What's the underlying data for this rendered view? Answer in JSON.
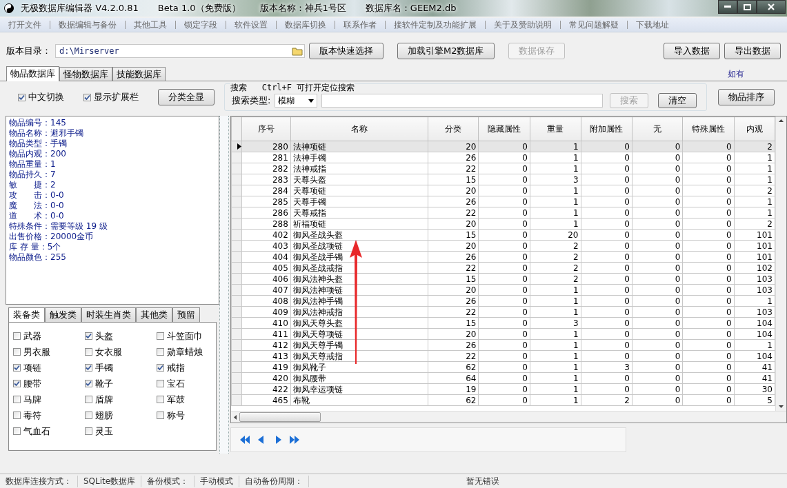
{
  "window": {
    "title_parts": [
      "无极数据库编辑器 V4.2.0.81",
      "Beta 1.0（免费版）",
      "版本名称：神兵1号区",
      "数据库名：GEEM2.db"
    ]
  },
  "menu": [
    "打开文件",
    "数据编辑与备份",
    "其他工具",
    "锁定字段",
    "软件设置",
    "数据库切换",
    "联系作者",
    "接软件定制及功能扩展",
    "关于及赞助说明",
    "常见问题解疑",
    "下载地址"
  ],
  "toolbar": {
    "dir_label": "版本目录：",
    "dir_value": "d:\\Mirserver",
    "buttons": [
      {
        "label": "版本快速选择",
        "disabled": false
      },
      {
        "label": "加载引擎M2数据库",
        "disabled": false
      },
      {
        "label": "数据保存",
        "disabled": true
      },
      {
        "label": "导入数据",
        "disabled": false
      },
      {
        "label": "导出数据",
        "disabled": false
      }
    ]
  },
  "main_tabs": [
    {
      "label": "物品数据库",
      "selected": true
    },
    {
      "label": "怪物数据库",
      "selected": false
    },
    {
      "label": "技能数据库",
      "selected": false
    }
  ],
  "link": "如有",
  "options": [
    {
      "label": "中文切换",
      "checked": true
    },
    {
      "label": "显示扩展栏",
      "checked": true
    }
  ],
  "show_all_button": "分类全显",
  "search": {
    "title": "搜索",
    "hint": "Ctrl+F 可打开定位搜索",
    "type_label": "搜索类型:",
    "type_value": "模糊",
    "search_button": {
      "label": "搜索",
      "disabled": true
    },
    "clear_button": "清空"
  },
  "sort_button": "物品排序",
  "info_lines": [
    "物品编号：145",
    "物品名称：避邪手镯",
    "物品类型：手镯",
    "物品内观：200",
    "物品重量：1",
    "物品持久：7",
    "敏　　捷：2",
    "攻　　击：0-0",
    "魔　　法：0-0",
    "道　　术：0-0",
    "特殊条件：需要等级 19 级",
    "出售价格：20000金币",
    "库 存 量：5个",
    "物品颜色：255"
  ],
  "category_tabs": [
    {
      "label": "装备类",
      "selected": true
    },
    {
      "label": "触发类",
      "selected": false
    },
    {
      "label": "时装生肖类",
      "selected": false
    },
    {
      "label": "其他类",
      "selected": false
    },
    {
      "label": "预留",
      "selected": false
    }
  ],
  "categories": [
    {
      "label": "武器",
      "checked": false
    },
    {
      "label": "头盔",
      "checked": true
    },
    {
      "label": "斗笠面巾",
      "checked": false
    },
    {
      "label": "男衣服",
      "checked": false
    },
    {
      "label": "女衣服",
      "checked": false
    },
    {
      "label": "勋章蜡烛",
      "checked": false
    },
    {
      "label": "项链",
      "checked": true
    },
    {
      "label": "手镯",
      "checked": true
    },
    {
      "label": "戒指",
      "checked": true
    },
    {
      "label": "腰带",
      "checked": true
    },
    {
      "label": "靴子",
      "checked": true
    },
    {
      "label": "宝石",
      "checked": false
    },
    {
      "label": "马牌",
      "checked": false
    },
    {
      "label": "盾牌",
      "checked": false
    },
    {
      "label": "军鼓",
      "checked": false
    },
    {
      "label": "毒符",
      "checked": false
    },
    {
      "label": "翅膀",
      "checked": false
    },
    {
      "label": "称号",
      "checked": false
    },
    {
      "label": "气血石",
      "checked": false
    },
    {
      "label": "灵玉",
      "checked": false
    }
  ],
  "table": {
    "columns": [
      "序号",
      "名称",
      "分类",
      "隐藏属性",
      "重量",
      "附加属性",
      "无",
      "特殊属性",
      "内观"
    ],
    "rows": [
      {
        "selected": true,
        "cells": [
          "280",
          "法神项链",
          "20",
          "0",
          "1",
          "0",
          "0",
          "0",
          "2"
        ]
      },
      {
        "selected": false,
        "cells": [
          "281",
          "法神手镯",
          "26",
          "0",
          "1",
          "0",
          "0",
          "0",
          "1"
        ]
      },
      {
        "selected": false,
        "cells": [
          "282",
          "法神戒指",
          "22",
          "0",
          "1",
          "0",
          "0",
          "0",
          "1"
        ]
      },
      {
        "selected": false,
        "cells": [
          "283",
          "天尊头盔",
          "15",
          "0",
          "3",
          "0",
          "0",
          "0",
          "1"
        ]
      },
      {
        "selected": false,
        "cells": [
          "284",
          "天尊项链",
          "20",
          "0",
          "1",
          "0",
          "0",
          "0",
          "2"
        ]
      },
      {
        "selected": false,
        "cells": [
          "285",
          "天尊手镯",
          "26",
          "0",
          "1",
          "0",
          "0",
          "0",
          "1"
        ]
      },
      {
        "selected": false,
        "cells": [
          "286",
          "天尊戒指",
          "22",
          "0",
          "1",
          "0",
          "0",
          "0",
          "1"
        ]
      },
      {
        "selected": false,
        "cells": [
          "288",
          "祈福项链",
          "20",
          "0",
          "1",
          "0",
          "0",
          "0",
          "2"
        ]
      },
      {
        "selected": false,
        "cells": [
          "402",
          "御风圣战头盔",
          "15",
          "0",
          "20",
          "0",
          "0",
          "0",
          "101"
        ]
      },
      {
        "selected": false,
        "cells": [
          "403",
          "御风圣战项链",
          "20",
          "0",
          "2",
          "0",
          "0",
          "0",
          "101"
        ]
      },
      {
        "selected": false,
        "cells": [
          "404",
          "御风圣战手镯",
          "26",
          "0",
          "2",
          "0",
          "0",
          "0",
          "101"
        ]
      },
      {
        "selected": false,
        "cells": [
          "405",
          "御风圣战戒指",
          "22",
          "0",
          "2",
          "0",
          "0",
          "0",
          "102"
        ]
      },
      {
        "selected": false,
        "cells": [
          "406",
          "御风法神头盔",
          "15",
          "0",
          "2",
          "0",
          "0",
          "0",
          "103"
        ]
      },
      {
        "selected": false,
        "cells": [
          "407",
          "御风法神项链",
          "20",
          "0",
          "1",
          "0",
          "0",
          "0",
          "103"
        ]
      },
      {
        "selected": false,
        "cells": [
          "408",
          "御风法神手镯",
          "26",
          "0",
          "1",
          "0",
          "0",
          "0",
          "1"
        ]
      },
      {
        "selected": false,
        "cells": [
          "409",
          "御风法神戒指",
          "22",
          "0",
          "1",
          "0",
          "0",
          "0",
          "103"
        ]
      },
      {
        "selected": false,
        "cells": [
          "410",
          "御风天尊头盔",
          "15",
          "0",
          "3",
          "0",
          "0",
          "0",
          "104"
        ]
      },
      {
        "selected": false,
        "cells": [
          "411",
          "御风天尊项链",
          "20",
          "0",
          "1",
          "0",
          "0",
          "0",
          "104"
        ]
      },
      {
        "selected": false,
        "cells": [
          "412",
          "御风天尊手镯",
          "26",
          "0",
          "1",
          "0",
          "0",
          "0",
          "1"
        ]
      },
      {
        "selected": false,
        "cells": [
          "413",
          "御风天尊戒指",
          "22",
          "0",
          "1",
          "0",
          "0",
          "0",
          "104"
        ]
      },
      {
        "selected": false,
        "cells": [
          "419",
          "御风靴子",
          "62",
          "0",
          "1",
          "3",
          "0",
          "0",
          "41"
        ]
      },
      {
        "selected": false,
        "cells": [
          "420",
          "御风腰带",
          "64",
          "0",
          "1",
          "0",
          "0",
          "0",
          "41"
        ]
      },
      {
        "selected": false,
        "cells": [
          "422",
          "御风幸运项链",
          "19",
          "0",
          "1",
          "0",
          "0",
          "0",
          "30"
        ]
      },
      {
        "selected": false,
        "cells": [
          "465",
          "布靴",
          "62",
          "0",
          "1",
          "2",
          "0",
          "0",
          "5"
        ]
      }
    ]
  },
  "status_bar": [
    "数据库连接方式：",
    "SQLite数据库",
    "备份模式：",
    "手动模式",
    "自动备份周期：",
    "暂无错误"
  ]
}
